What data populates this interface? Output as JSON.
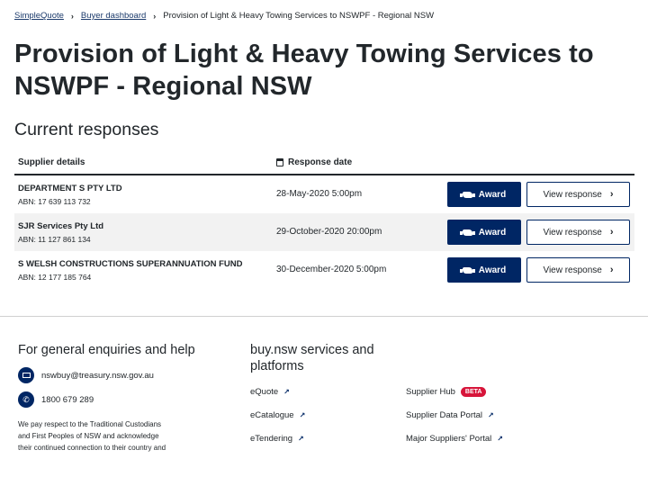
{
  "breadcrumb": {
    "items": [
      "SimpleQuote",
      "Buyer dashboard",
      "Provision of Light & Heavy Towing Services to NSWPF - Regional NSW"
    ],
    "sep": "›"
  },
  "page": {
    "title": "Provision of Light & Heavy Towing Services to NSWPF - Regional NSW",
    "section_title": "Current responses"
  },
  "table": {
    "col_supplier": "Supplier details",
    "col_date": "Response date",
    "award_label": "Award",
    "view_label": "View response",
    "rows": [
      {
        "name": "DEPARTMENT S PTY LTD",
        "abn": "ABN: 17 639 113 732",
        "date": "28-May-2020 5:00pm"
      },
      {
        "name": "SJR Services Pty Ltd",
        "abn": "ABN: 11 127 861 134",
        "date": "29-October-2020 20:00pm"
      },
      {
        "name": "S WELSH CONSTRUCTIONS SUPERANNUATION FUND",
        "abn": "ABN: 12 177 185 764",
        "date": "30-December-2020 5:00pm"
      }
    ]
  },
  "footer": {
    "enquiries_title": "For general enquiries and help",
    "email": "nswbuy@treasury.nsw.gov.au",
    "phone": "1800 679 289",
    "respect": "We pay respect to the Traditional Custodians and First Peoples of NSW and acknowledge their continued connection to their country and",
    "services_title": "buy.nsw services and platforms",
    "links": [
      "eQuote",
      "eCatalogue",
      "eTendering",
      "Supplier Hub",
      "Supplier Data Portal",
      "Major Suppliers' Portal"
    ],
    "beta_badge": "BETA"
  },
  "colors": {
    "primary": "#002664",
    "beta": "#d7153a",
    "row_alt": "#f2f2f2"
  }
}
